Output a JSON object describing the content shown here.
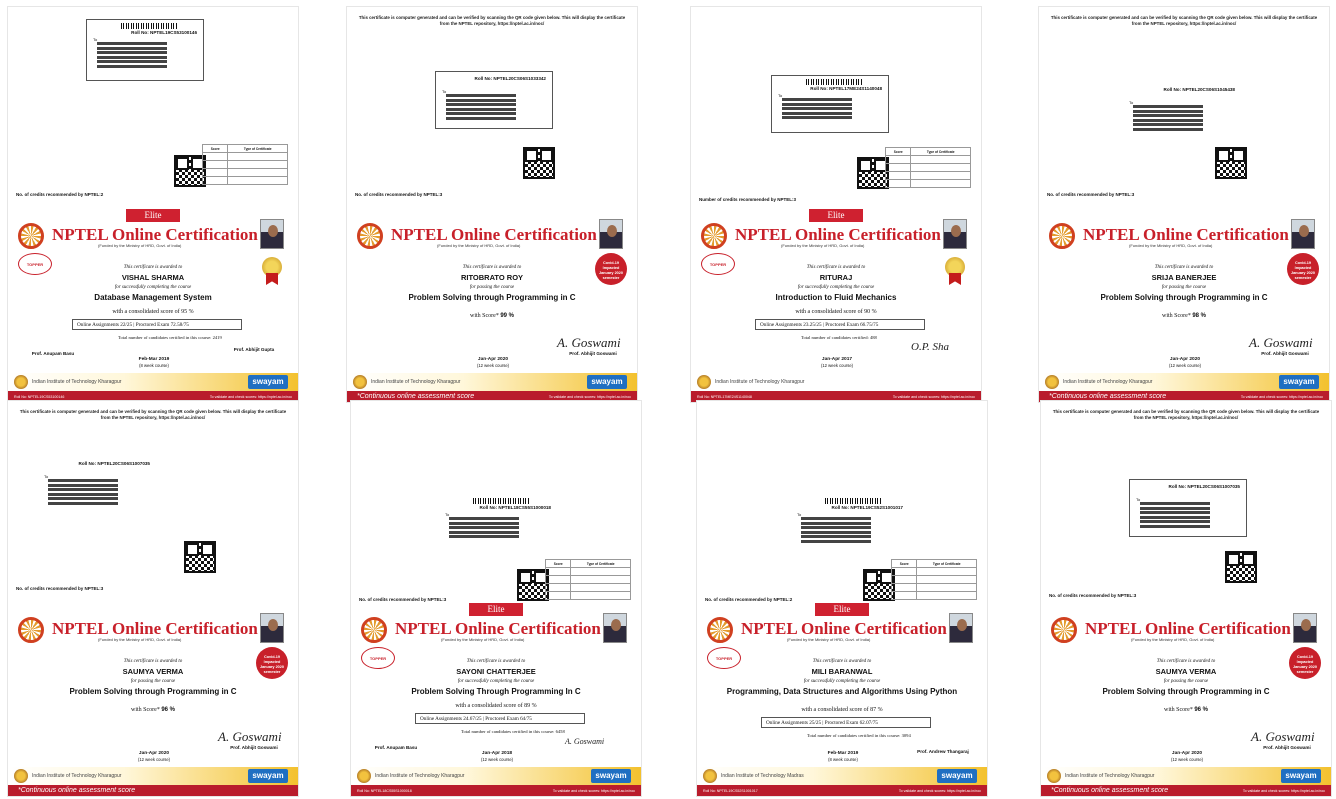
{
  "notice": "This certificate is computer generated and can be verified by scanning the QR code given below. This will display the certificate from the NPTEL repository, https://nptel.ac.in/noc/",
  "common": {
    "to": "To",
    "credits_2": "No. of credits recommended by NPTEL:2",
    "credits_3": "No. of credits recommended by NPTEL:3",
    "number_credits_3": "Number of credits recommended by NPTEL:3",
    "elite": "Elite",
    "title": "NPTEL Online Certification",
    "subtitle": "(Funded by the Ministry of HRD, Govt. of India)",
    "awarded": "This certificate is awarded to",
    "for_completing": "for successfully completing the course",
    "for_passing": "for passing the course",
    "topper": "TOPPER",
    "covid": "Covid-19 Impacted January 2020 semester",
    "iit_kgp": "Indian Institute of Technology Kharagpur",
    "iit_madras": "Indian Institute of Technology Madras",
    "swayam": "swayam",
    "continuous": "*Continuous online assessment score",
    "verify": "To validate and check scores: https://nptel.ac.in/noc",
    "online_assignments": "Online Assignments",
    "proctored_exam": "Proctored Exam",
    "score_header": "Score",
    "type_header": "Type of Certificate",
    "with_score": "with Score*",
    "twelve_week": "(12 week course)",
    "eight_week": "(8 week course)"
  },
  "certificates": [
    {
      "roll": "Roll No: NPTEL19CS53100146",
      "name": "VISHAL SHARMA",
      "course": "Database Management System",
      "consolidated": "with a consolidated score of 95 %",
      "assignments": "22/25",
      "exam": "72.58/75",
      "total": "Total number of candidates certified in this course: 2419",
      "session": "Feb-Mar 2019",
      "sig_left": "Prof. Anupam Basu",
      "sig_right": "Prof. Abhijit Gupta"
    },
    {
      "roll": "Roll No: NPTEL20CS06S1033342",
      "name": "RITOBRATO ROY",
      "course": "Problem Solving through Programming in C",
      "score": "99 %",
      "session": "Jan-Apr 2020",
      "sig_left": "",
      "sig_right": "Prof. Abhijit Goswami"
    },
    {
      "roll": "Roll No: NPTEL17ME24S1140048",
      "name": "RITURAJ",
      "course": "Introduction to Fluid Mechanics",
      "consolidated": "with a consolidated score of 90 %",
      "assignments": "23.25/25",
      "exam": "66.75/75",
      "total": "Total number of candidates certified: 488",
      "session": "Jan-Apr 2017",
      "sig_left": "",
      "sig_right": "O.P. Sha"
    },
    {
      "roll": "Roll No: NPTEL20CS06S1045438",
      "name": "SRIJA BANERJEE",
      "course": "Problem Solving through Programming in C",
      "score": "98 %",
      "session": "Jan-Apr 2020",
      "sig_left": "",
      "sig_right": "Prof. Abhijit Goswami"
    },
    {
      "roll": "Roll No: NPTEL20CS06S1007035",
      "name": "SAUMYA VERMA",
      "course": "Problem Solving through Programming in C",
      "score": "96 %",
      "session": "Jan-Apr 2020",
      "sig_left": "",
      "sig_right": "Prof. Abhijit Goswami"
    },
    {
      "roll": "Roll No: NPTEL18CS55S1000018",
      "name": "SAYONI CHATTERJEE",
      "course": "Problem Solving Through Programming In C",
      "consolidated": "with a consolidated score of 89 %",
      "assignments": "24.67/25",
      "exam": "64/75",
      "total": "Total number of candidates certified in this course: 6458",
      "session": "Jan-Apr 2018",
      "sig_left": "Prof. Anupam Basu",
      "sig_right": "A. Goswami"
    },
    {
      "roll": "Roll No: NPTEL19CS52S1001017",
      "name": "MILI BARANWAL",
      "course": "Programming, Data Structures and Algorithms Using Python",
      "consolidated": "with a consolidated score of 87 %",
      "assignments": "25/25",
      "exam": "62.07/75",
      "total": "Total number of candidates certified in this course: 3094",
      "session": "Feb-Mar 2019",
      "sig_left": "",
      "sig_right": "Prof. Andrew Thangaraj"
    },
    {
      "roll": "Roll No: NPTEL20CS06S1007035",
      "name": "SAUMYA VERMA",
      "course": "Problem Solving through Programming in C",
      "score": "96 %",
      "session": "Jan-Apr 2020",
      "sig_left": "",
      "sig_right": "Prof. Abhijit Goswami"
    }
  ]
}
